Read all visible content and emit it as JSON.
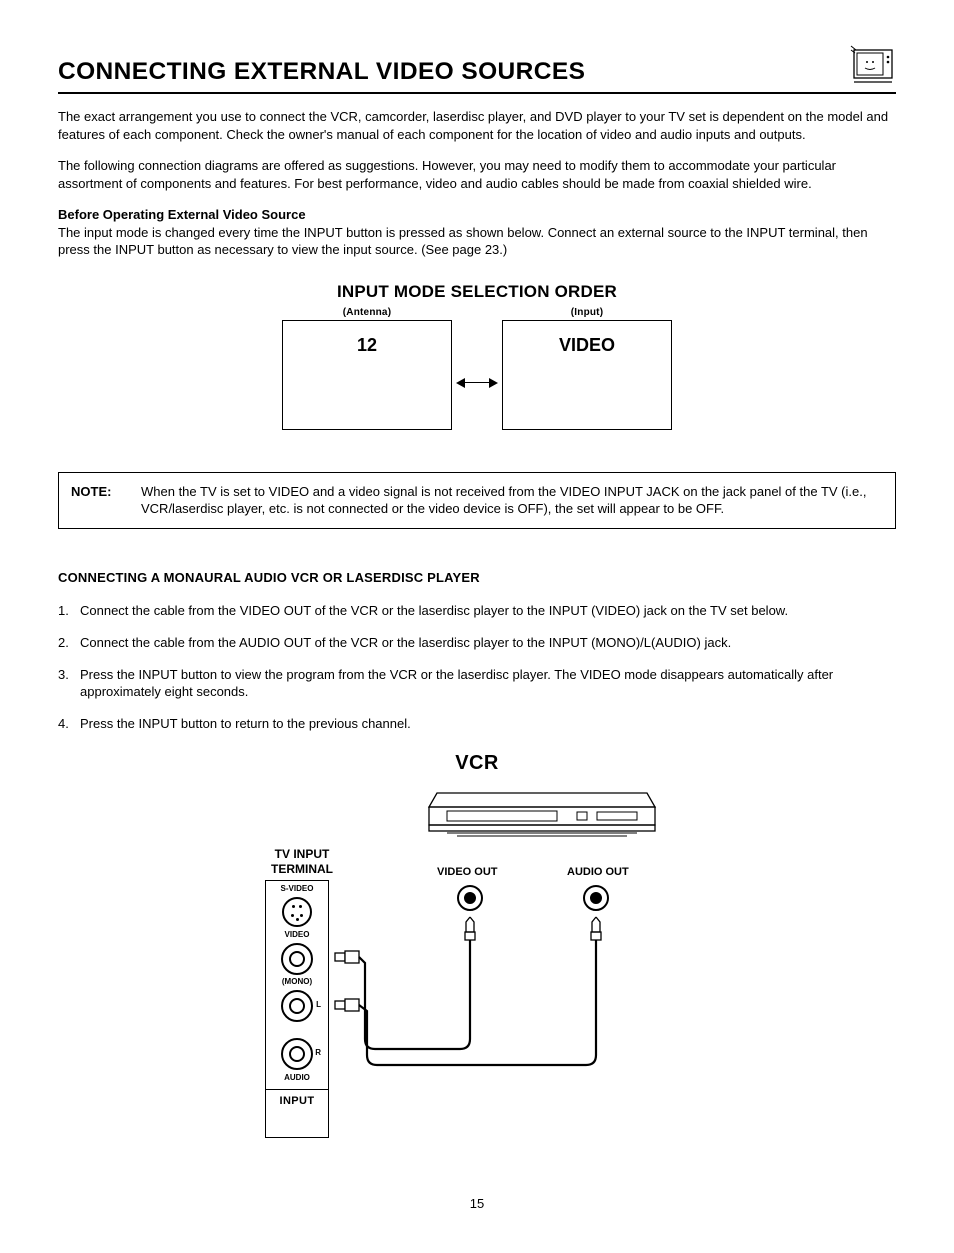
{
  "title": "CONNECTING EXTERNAL VIDEO SOURCES",
  "intro1": "The exact arrangement you use to connect the VCR, camcorder, laserdisc player, and DVD player to your TV set is dependent on the model and features of each component.  Check the owner's manual of each component for the location of video and audio inputs and outputs.",
  "intro2": "The following connection diagrams are offered as suggestions.  However, you may need to modify them to accommodate your particular assortment of components and features.  For best performance, video and audio cables should be made from coaxial shielded wire.",
  "before_heading": "Before Operating External Video Source",
  "before_body": "The input mode is changed every time the INPUT button is pressed as shown below.  Connect an external source to the INPUT terminal, then press the INPUT button as necessary to view the input source.  (See page 23.)",
  "diagram": {
    "title": "INPUT MODE SELECTION ORDER",
    "left_caption": "(Antenna)",
    "right_caption": "(Input)",
    "left_value": "12",
    "right_value": "VIDEO"
  },
  "note": {
    "label": "NOTE:",
    "body": "When the TV is set to VIDEO and a video signal is not received from the VIDEO INPUT JACK on the jack panel of the TV (i.e., VCR/laserdisc player, etc. is not connected or the video device is OFF), the set will appear to be OFF."
  },
  "sub_heading": "CONNECTING A MONAURAL AUDIO VCR OR LASERDISC PLAYER",
  "steps": [
    "Connect the cable from the VIDEO OUT of the VCR or the laserdisc player to the INPUT (VIDEO) jack on the TV set below.",
    "Connect the cable from the AUDIO OUT of the VCR or the laserdisc player to the INPUT (MONO)/L(AUDIO) jack.",
    "Press the INPUT button to view the program from the VCR or the laserdisc player.  The VIDEO mode disappears automatically after approximately eight seconds.",
    "Press the INPUT button to return to the previous channel."
  ],
  "vcr": {
    "title": "VCR",
    "terminal_label": "TV INPUT TERMINAL",
    "svideo": "S-VIDEO",
    "video": "VIDEO",
    "mono": "(MONO)",
    "l": "L",
    "r": "R",
    "audio": "AUDIO",
    "input": "INPUT",
    "video_out": "VIDEO OUT",
    "audio_out": "AUDIO OUT"
  },
  "page_number": "15"
}
